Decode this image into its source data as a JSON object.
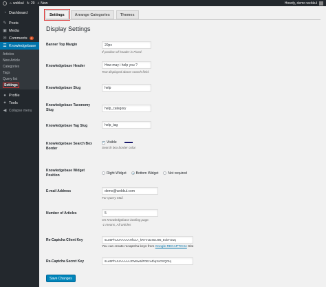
{
  "adminbar": {
    "site_name": "webkul",
    "updates_count": "29",
    "new_label": "New",
    "howdy": "Howdy, demo webkul"
  },
  "sidebar": {
    "items": [
      {
        "label": "Dashboard",
        "icon": "dashboard-icon"
      },
      {
        "label": "Posts",
        "icon": "pin-icon"
      },
      {
        "label": "Media",
        "icon": "media-icon"
      },
      {
        "label": "Comments",
        "icon": "comment-icon",
        "badge": "0"
      },
      {
        "label": "Knowledgebase",
        "icon": "book-icon"
      }
    ],
    "submenu": [
      "Articles",
      "New Article",
      "Categories",
      "Tags",
      "Query list",
      "Settings"
    ],
    "bottom_items": [
      {
        "label": "Profile",
        "icon": "user-icon"
      },
      {
        "label": "Tools",
        "icon": "wrench-icon"
      }
    ],
    "collapse_label": "Collapse menu"
  },
  "tabs": [
    "Settings",
    "Arrange Categories",
    "Themes"
  ],
  "page_title": "Display Settings",
  "fields": {
    "banner_top_margin": {
      "label": "Banner Top Margin",
      "value": "20px",
      "desc": "If position of header is Fixed."
    },
    "kb_header": {
      "label": "Knowledgebase Header",
      "value": "How may i help you ?",
      "desc": "Text displayed above search field."
    },
    "kb_slug": {
      "label": "Knowledgebase Slug",
      "value": "help"
    },
    "kb_taxonomy_slug": {
      "label": "Knowledgebase Taxonomy Slug",
      "value": "help_category"
    },
    "kb_tag_slug": {
      "label": "Knowledgebase Tag Slug",
      "value": "help_tag"
    },
    "kb_search_border": {
      "label": "Knowledgebase Search Box Border",
      "checkbox_label": "Visible",
      "desc": "Search box border color.",
      "color": "#1a1a6e"
    },
    "kb_widget_position": {
      "label": "Knowledgebase Widget Position",
      "options": [
        "Right Widget",
        "Bottom Widget",
        "Not required"
      ],
      "selected": "Bottom Widget"
    },
    "email": {
      "label": "E-mail Address",
      "value": "demo@webkul.com",
      "desc": "For Query Mail."
    },
    "num_articles": {
      "label": "Number of Articles",
      "value": "5",
      "desc1": "On Knowledgebase landing page.",
      "desc2": "-1 means, All articles"
    },
    "recaptcha_client": {
      "label": "Re-Captcha Client Key",
      "value": "6LeBPhUUAAAAAHfCzA_kRYm3z46zJ95_EvbTUwq",
      "desc_prefix": "You can create recaptcha keys from",
      "link": "Google RECAPTCHA",
      "desc_suffix": "Site"
    },
    "recaptcha_secret": {
      "label": "Re-Captcha Secret Key",
      "value": "6LeBPhUUAAAAAJOWawtdF0Ezx4bq3oOXQOIq"
    }
  },
  "save_label": "Save Changes"
}
